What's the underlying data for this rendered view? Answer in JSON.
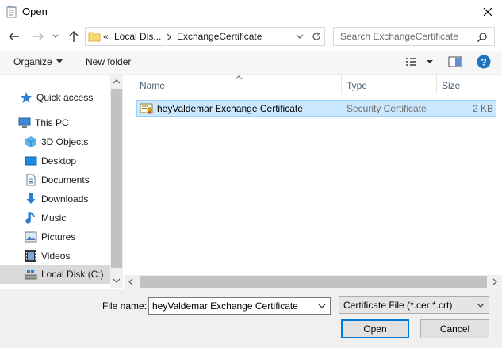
{
  "window": {
    "title": "Open"
  },
  "address": {
    "overflow": "«",
    "crumbs": [
      "Local Dis...",
      "ExchangeCertificate"
    ]
  },
  "search": {
    "placeholder": "Search ExchangeCertificate"
  },
  "toolbar": {
    "organize": "Organize",
    "new_folder": "New folder"
  },
  "nav": {
    "items": [
      {
        "label": "Quick access",
        "icon": "star-icon"
      },
      {
        "label": "This PC",
        "icon": "computer-icon"
      },
      {
        "label": "3D Objects",
        "icon": "cube-icon"
      },
      {
        "label": "Desktop",
        "icon": "desktop-icon"
      },
      {
        "label": "Documents",
        "icon": "document-icon"
      },
      {
        "label": "Downloads",
        "icon": "download-icon"
      },
      {
        "label": "Music",
        "icon": "music-icon"
      },
      {
        "label": "Pictures",
        "icon": "pictures-icon"
      },
      {
        "label": "Videos",
        "icon": "videos-icon"
      },
      {
        "label": "Local Disk (C:)",
        "icon": "disk-icon"
      }
    ]
  },
  "columns": {
    "name": "Name",
    "type": "Type",
    "size": "Size"
  },
  "files": [
    {
      "name": "heyValdemar Exchange Certificate",
      "type": "Security Certificate",
      "size": "2 KB"
    }
  ],
  "bottom": {
    "file_name_label": "File name:",
    "file_name_value": "heyValdemar Exchange Certificate",
    "file_type_value": "Certificate File (*.cer;*.crt)",
    "open": "Open",
    "cancel": "Cancel"
  },
  "colors": {
    "accent": "#0078d7",
    "selection": "#cce8ff",
    "help": "#1e73be"
  }
}
